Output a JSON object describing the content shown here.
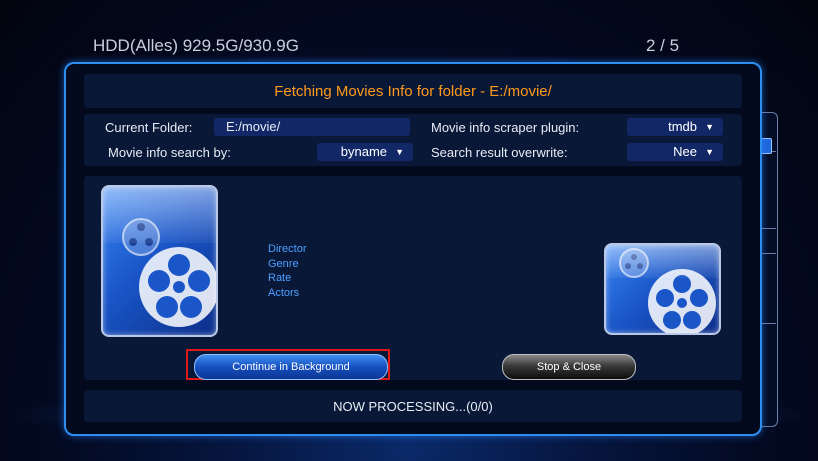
{
  "header": {
    "storage": "HDD(Alles) 929.5G/930.9G",
    "page_indicator": "2 / 5"
  },
  "dialog": {
    "title": "Fetching Movies Info for folder - E:/movie/",
    "current_folder_label": "Current Folder:",
    "current_folder_value": "E:/movie/",
    "search_by_label": "Movie info search by:",
    "search_by_value": "byname",
    "scraper_label": "Movie info scraper plugin:",
    "scraper_value": "tmdb",
    "overwrite_label": "Search result overwrite:",
    "overwrite_value": "Nee",
    "info_fields": [
      "Director",
      "Genre",
      "Rate",
      "Actors"
    ],
    "continue_button": "Continue in Background",
    "stop_button": "Stop & Close",
    "status": "NOW PROCESSING...(0/0)"
  },
  "icons": {
    "large_poster": "film-reel-icon",
    "small_poster": "film-reel-icon",
    "dropdown_arrow": "chevron-down-icon"
  },
  "colors": {
    "title": "#ff9a1a",
    "accent": "#2e8ef0",
    "info_text": "#4da0ff",
    "focus": "#e01818"
  }
}
